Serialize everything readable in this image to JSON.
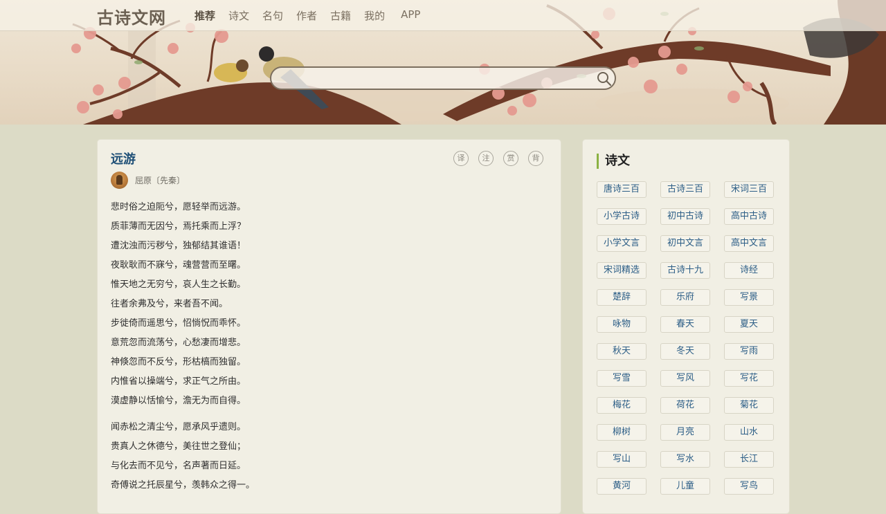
{
  "site": {
    "logo": "古诗文网"
  },
  "nav": [
    "推荐",
    "诗文",
    "名句",
    "作者",
    "古籍",
    "我的",
    "APP"
  ],
  "search": {
    "placeholder": ""
  },
  "poem": {
    "title": "远游",
    "author": "屈原〔先秦〕",
    "tools": [
      "译",
      "注",
      "赏",
      "背"
    ],
    "stanzas": [
      [
        "悲时俗之迫阨兮，愿轻举而远游。",
        "质菲薄而无因兮，焉托乘而上浮？",
        "遭沈浊而污秽兮，独郁结其谁语！",
        "夜耿耿而不寐兮，魂营营而至曙。",
        "惟天地之无穷兮，哀人生之长勤。",
        "往者余弗及兮，来者吾不闻。",
        "步徙倚而遥思兮，怊惝怳而乖怀。",
        "意荒忽而流荡兮，心愁凄而增悲。",
        "神倏忽而不反兮，形枯槁而独留。",
        "内惟省以操端兮，求正气之所由。",
        "漠虚静以恬愉兮，澹无为而自得。"
      ],
      [
        "闻赤松之清尘兮，愿承风乎遗则。",
        "贵真人之休德兮，美往世之登仙；",
        "与化去而不见兮，名声著而日延。",
        "奇傅说之托辰星兮，羡韩众之得一。"
      ]
    ]
  },
  "sidebar": {
    "title": "诗文",
    "tags": [
      "唐诗三百",
      "古诗三百",
      "宋词三百",
      "小学古诗",
      "初中古诗",
      "高中古诗",
      "小学文言",
      "初中文言",
      "高中文言",
      "宋词精选",
      "古诗十九",
      "诗经",
      "楚辞",
      "乐府",
      "写景",
      "咏物",
      "春天",
      "夏天",
      "秋天",
      "冬天",
      "写雨",
      "写雪",
      "写风",
      "写花",
      "梅花",
      "荷花",
      "菊花",
      "柳树",
      "月亮",
      "山水",
      "写山",
      "写水",
      "长江",
      "黄河",
      "儿童",
      "写鸟"
    ]
  },
  "colors": {
    "accent_green": "#8bb243",
    "link_blue": "#2b5d86",
    "title_blue": "#1e4f76",
    "page_bg": "#dcdbc6"
  }
}
